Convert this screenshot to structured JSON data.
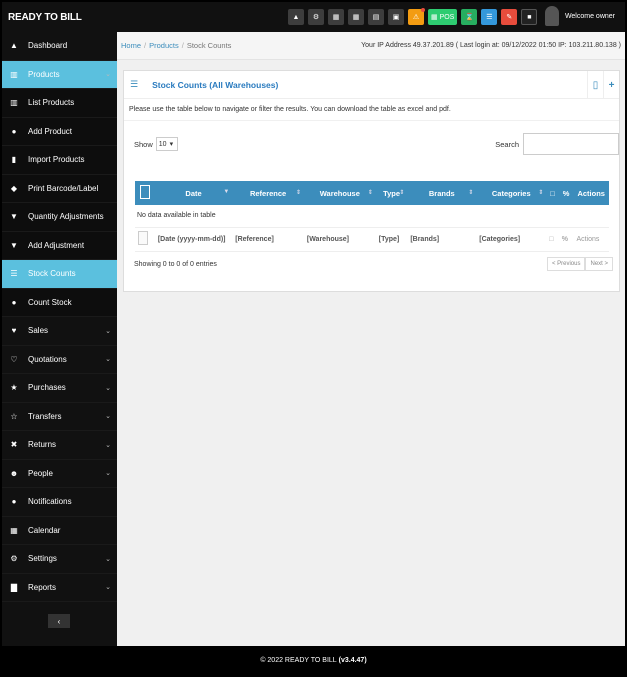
{
  "brand": "READY TO BILL",
  "topbar": {
    "pos_label": "POS",
    "welcome": "Welcome owner"
  },
  "sidebar": {
    "items": [
      {
        "label": "Dashboard",
        "icon": "dashboard-icon",
        "glyph": "▲"
      },
      {
        "label": "Products",
        "icon": "barcode-icon",
        "glyph": "▥"
      },
      {
        "label": "List Products",
        "icon": "barcode-icon",
        "glyph": "▥"
      },
      {
        "label": "Add Product",
        "icon": "plus-circle-icon",
        "glyph": "●"
      },
      {
        "label": "Import Products",
        "icon": "file-icon",
        "glyph": "▮"
      },
      {
        "label": "Print Barcode/Label",
        "icon": "tag-icon",
        "glyph": "◆"
      },
      {
        "label": "Quantity Adjustments",
        "icon": "filter-icon",
        "glyph": "▼"
      },
      {
        "label": "Add Adjustment",
        "icon": "filter-icon",
        "glyph": "▼"
      },
      {
        "label": "Stock Counts",
        "icon": "list-icon",
        "glyph": "☰"
      },
      {
        "label": "Count Stock",
        "icon": "plus-circle-icon",
        "glyph": "●"
      },
      {
        "label": "Sales",
        "icon": "heart-icon",
        "glyph": "♥"
      },
      {
        "label": "Quotations",
        "icon": "heart-outline-icon",
        "glyph": "♡"
      },
      {
        "label": "Purchases",
        "icon": "star-icon",
        "glyph": "★"
      },
      {
        "label": "Transfers",
        "icon": "star-outline-icon",
        "glyph": "☆"
      },
      {
        "label": "Returns",
        "icon": "random-icon",
        "glyph": "✖"
      },
      {
        "label": "People",
        "icon": "users-icon",
        "glyph": "⚇"
      },
      {
        "label": "Notifications",
        "icon": "info-icon",
        "glyph": "●"
      },
      {
        "label": "Calendar",
        "icon": "calendar-icon",
        "glyph": "▦"
      },
      {
        "label": "Settings",
        "icon": "cog-icon",
        "glyph": "⚙"
      },
      {
        "label": "Reports",
        "icon": "chart-icon",
        "glyph": "▇"
      }
    ]
  },
  "breadcrumb": {
    "home": "Home",
    "products": "Products",
    "current": "Stock Counts"
  },
  "ip_info": "Your IP Address 49.37.201.89 ( Last login at: 09/12/2022 01:50 IP: 103.211.80.138 )",
  "box": {
    "title": "Stock Counts (All Warehouses)",
    "intro": "Please use the table below to navigate or filter the results. You can download the table as excel and pdf."
  },
  "controls": {
    "show_label": "Show",
    "page_size": "10",
    "search_label": "Search"
  },
  "table": {
    "headers": [
      "Date",
      "Reference",
      "Warehouse",
      "Type",
      "Brands",
      "Categories",
      "Actions"
    ],
    "empty_text": "No data available in table",
    "filters": [
      "[Date (yyyy-mm-dd)]",
      "[Reference]",
      "[Warehouse]",
      "[Type]",
      "[Brands]",
      "[Categories]",
      "Actions"
    ]
  },
  "pagination": {
    "info": "Showing 0 to 0 of 0 entries",
    "prev": "< Previous",
    "next": "Next >"
  },
  "footer": {
    "text": "© 2022 READY TO BILL",
    "version": "(v3.4.47)"
  }
}
